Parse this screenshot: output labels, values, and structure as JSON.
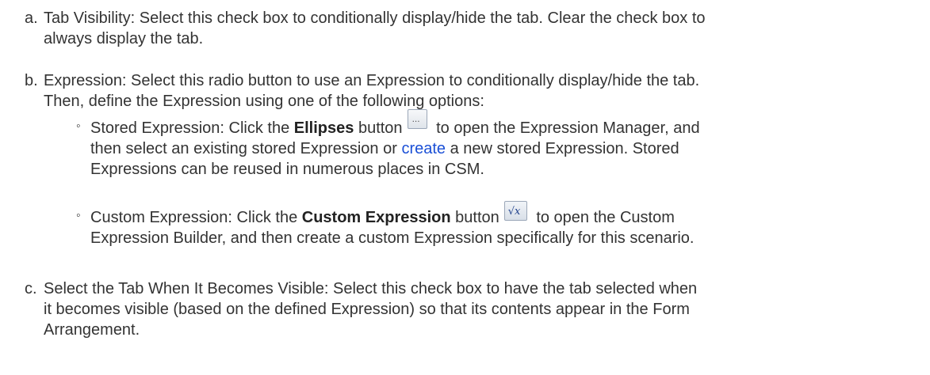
{
  "items": [
    {
      "marker": "a.",
      "label": "Tab Visibility:",
      "line1": " Select this check box to conditionally display/hide the tab. Clear the check box to",
      "line2": "always display the tab."
    },
    {
      "marker": "b.",
      "label": "Expression:",
      "line1": " Select this radio button to use an Expression to conditionally display/hide the tab.",
      "line2": "Then, define the Expression using one of the following options:",
      "sub": [
        {
          "bullet": "◦",
          "prefix": "Stored Expression: Click the ",
          "button_label": "Ellipses",
          "after_button": " button",
          "after_icon": " to open the Expression Manager, and",
          "line2_prefix": "then select an existing stored Expression or ",
          "link_text": "create",
          "line2_suffix": " a new stored Expression. Stored",
          "line3": "Expressions can be reused in numerous places in CSM.",
          "icon": "ellipsis-button-icon"
        },
        {
          "bullet": "◦",
          "prefix": "Custom Expression: Click the ",
          "button_label": "Custom Expression",
          "after_button": " button",
          "after_icon": " to open the Custom",
          "line2": "Expression Builder, and then create a custom Expression specifically for this scenario.",
          "icon": "custom-expression-fx-icon"
        }
      ]
    },
    {
      "marker": "c.",
      "label": "Select the Tab When It Becomes Visible:",
      "line1": " Select this check box to have the tab selected when",
      "line2": "it becomes visible (based on the defined Expression) so that its contents appear in the Form",
      "line3": "Arrangement."
    }
  ]
}
